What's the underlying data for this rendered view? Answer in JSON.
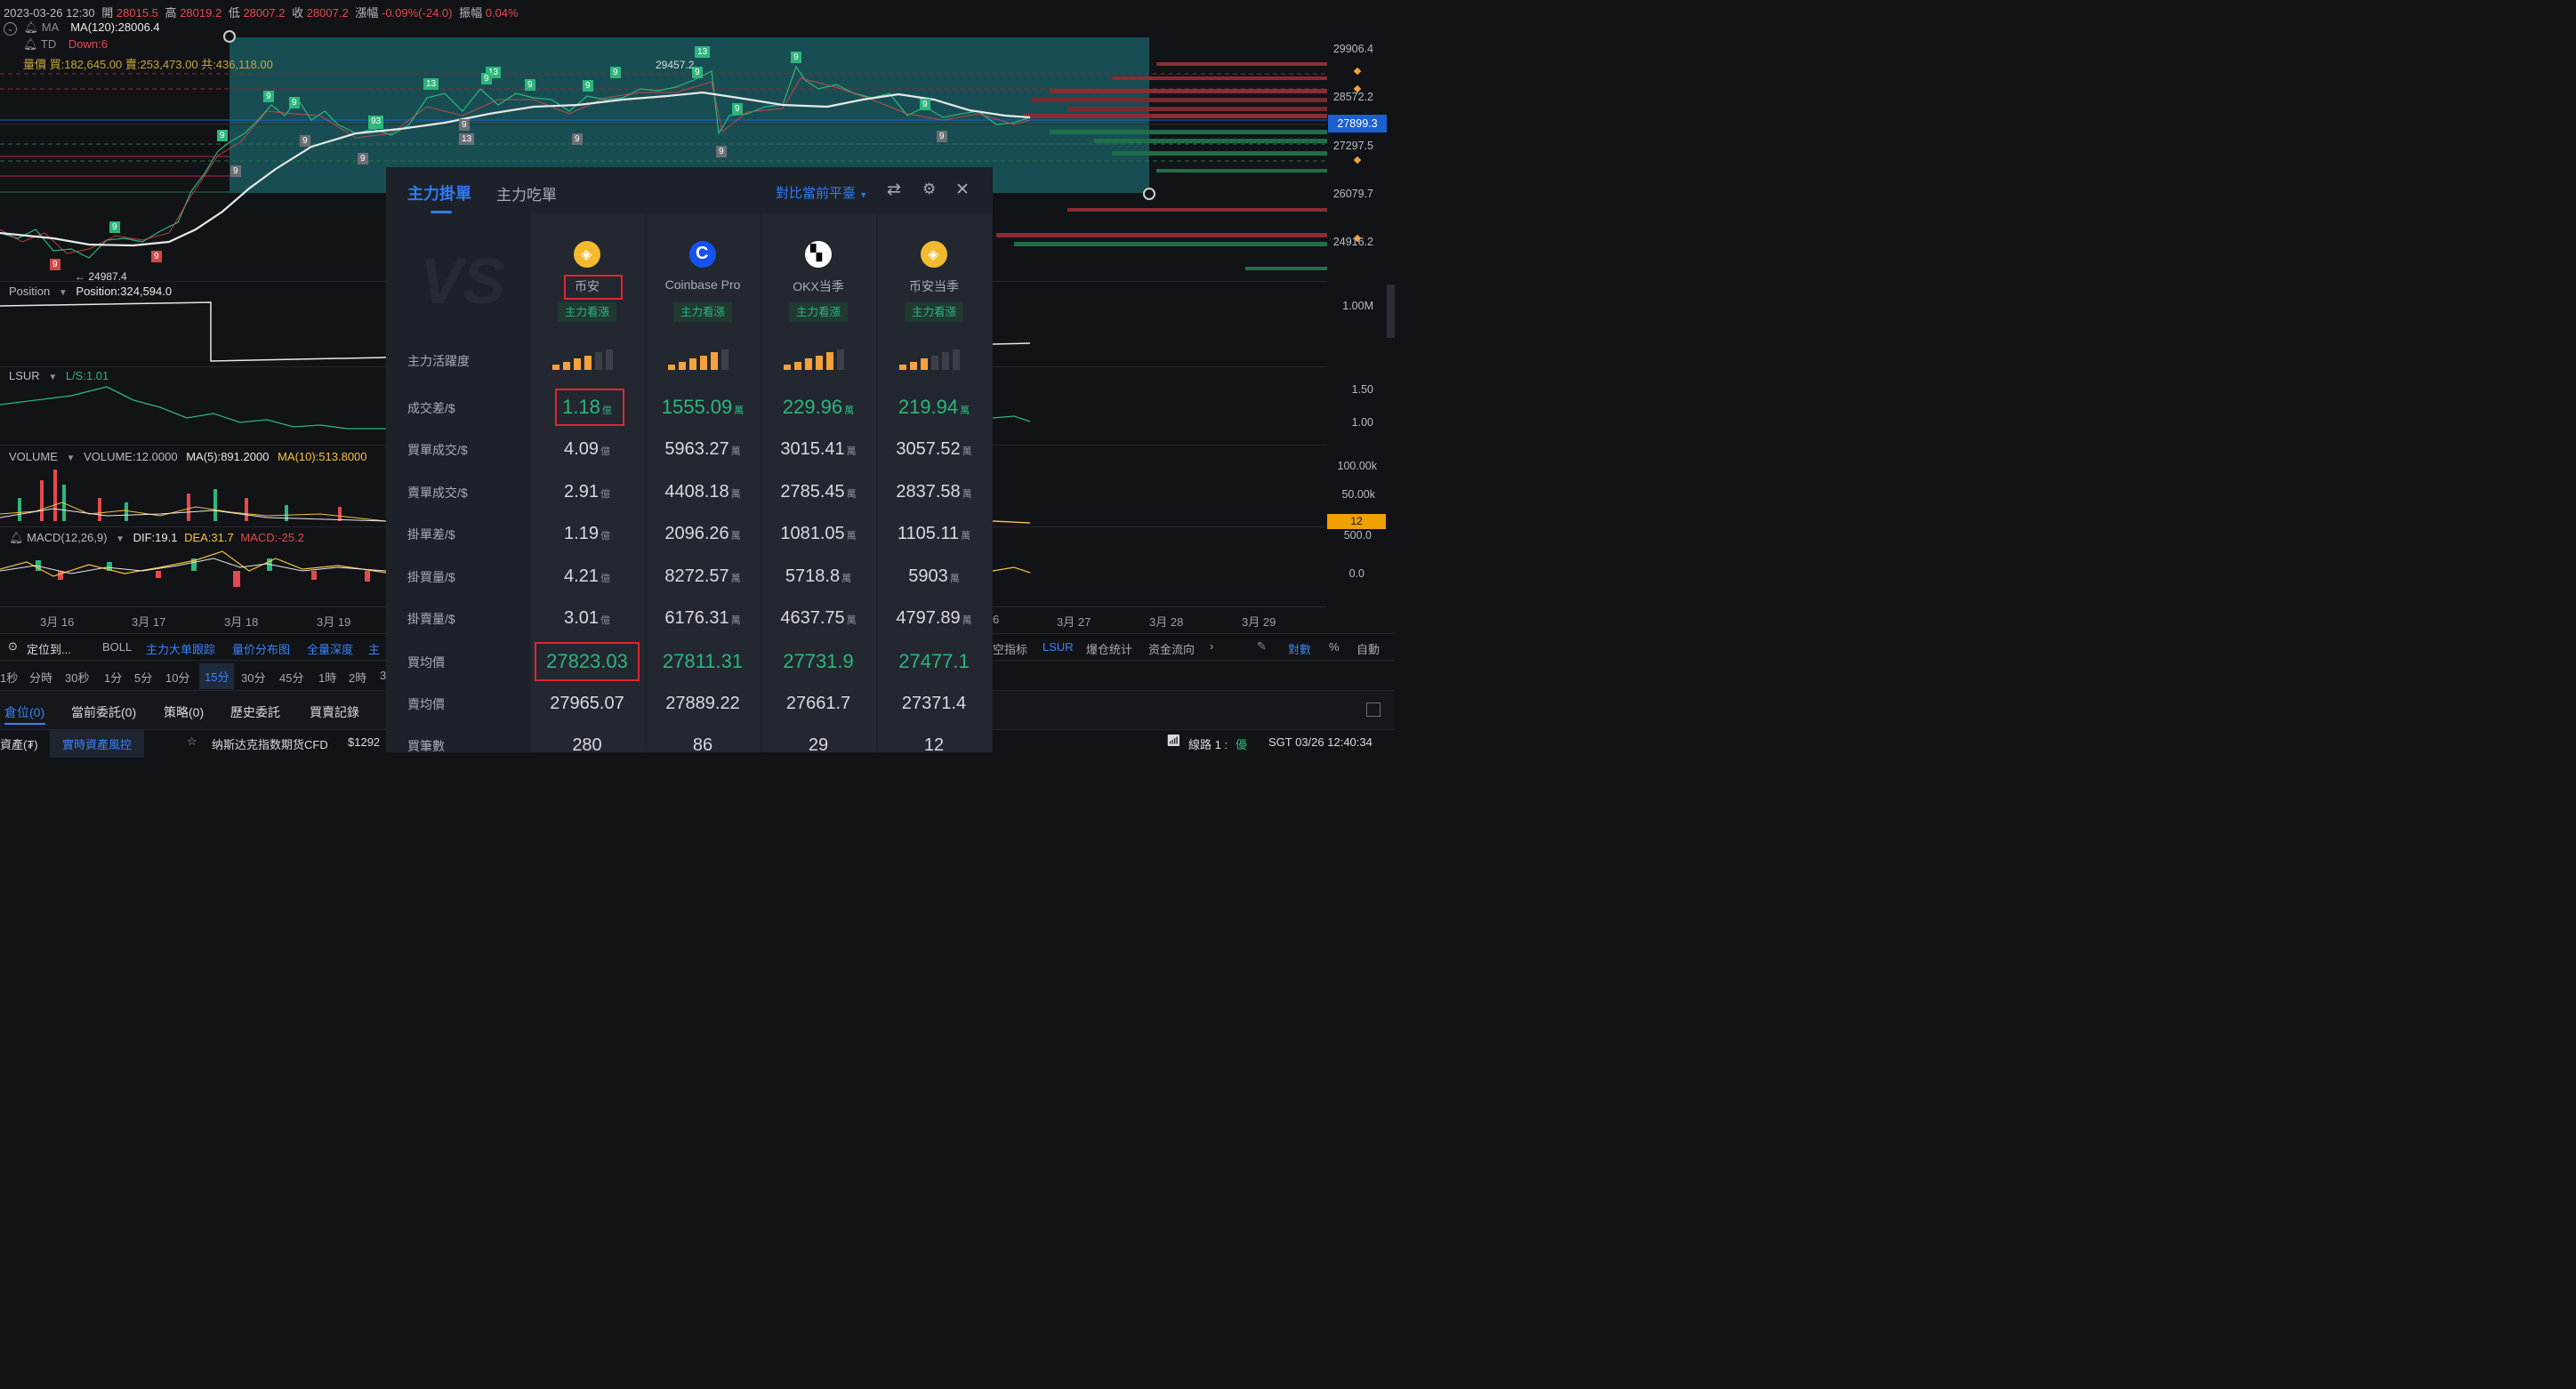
{
  "info": {
    "date": "2023-03-26 12:30",
    "open_label": "開",
    "open": "28015.5",
    "high_label": "高",
    "high": "28019.2",
    "low_label": "低",
    "low": "28007.2",
    "close_label": "收",
    "close": "28007.2",
    "change_label": "漲幅",
    "change": "-0.09%(-24.0)",
    "amp_label": "振幅",
    "amp": "0.04%"
  },
  "indicators": {
    "ma_name": "MA",
    "ma_value": "MA(120):28006.4",
    "td_name": "TD",
    "td_value": "Down:6",
    "vol_line": "量價 買:182,645.00 賣:253,473.00 共:436,118.00"
  },
  "chart_marks": {
    "low_price": "24987.4",
    "high_price": "29457.2",
    "td_counts": [
      "9",
      "9",
      "13",
      "9",
      "9",
      "9",
      "9",
      "93",
      "9",
      "9",
      "13",
      "13",
      "9",
      "9",
      "9",
      "9",
      "9",
      "13",
      "9",
      "9",
      "9",
      "9",
      "9",
      "9",
      "13",
      "9",
      "9"
    ]
  },
  "price_axis": [
    "29906.4",
    "28572.2",
    "27899.3",
    "27297.5",
    "26079.7",
    "24916.2"
  ],
  "panes": {
    "position": {
      "name": "Position",
      "value": "Position:324,594.0",
      "axis": "1.00M"
    },
    "lsur": {
      "name": "LSUR",
      "value": "L/S:1.01",
      "axis": [
        "1.50",
        "1.00"
      ]
    },
    "volume": {
      "name": "VOLUME",
      "value": "VOLUME:12.0000",
      "ma5": "MA(5):891.2000",
      "ma10": "MA(10):513.8000",
      "axis": [
        "100.00k",
        "50.00k"
      ],
      "current": "12"
    },
    "macd": {
      "name": "MACD(12,26,9)",
      "dif": "DIF:19.1",
      "dea": "DEA:31.7",
      "macd": "MACD:-25.2",
      "axis": [
        "500.0",
        "0.0"
      ]
    }
  },
  "x_axis": [
    "3月 16",
    "3月 17",
    "3月 18",
    "3月 19",
    "6",
    "3月 27",
    "3月 28",
    "3月 29"
  ],
  "toolbar1": {
    "locate": "定位到...",
    "items": [
      "BOLL",
      "主力大单跟踪",
      "量价分布图",
      "全量深度",
      "主"
    ],
    "right_items": [
      "空指标",
      "LSUR",
      "爆仓统计",
      "资金流向"
    ],
    "right_end": [
      "對數",
      "%",
      "自動"
    ]
  },
  "toolbar2": {
    "intervals": [
      "1秒",
      "分時",
      "30秒",
      "1分",
      "5分",
      "10分",
      "15分",
      "30分",
      "45分",
      "1時",
      "2時",
      "3"
    ],
    "active": "15分"
  },
  "toolbar3": {
    "tabs": [
      "倉位(0)",
      "當前委託(0)",
      "策略(0)",
      "歷史委託",
      "買賣記錄"
    ]
  },
  "status": {
    "assets": "資產(₮)",
    "risk": "實時資產風控",
    "ticker_name": "纳斯达克指数期货CFD",
    "ticker_price": "$1292",
    "line": "線路 1 :",
    "line_quality": "優",
    "time": "SGT 03/26 12:40:34"
  },
  "panel": {
    "tab_active": "主力掛單",
    "tab_other": "主力吃單",
    "compare": "對比當前平臺",
    "exchanges": [
      {
        "name": "币安",
        "badge": "主力看漲",
        "logo": "binance",
        "activity": 4
      },
      {
        "name": "Coinbase Pro",
        "badge": "主力看漲",
        "logo": "coinbase",
        "activity": 5
      },
      {
        "name": "OKX当季",
        "badge": "主力看漲",
        "logo": "okx",
        "activity": 5
      },
      {
        "name": "币安当季",
        "badge": "主力看漲",
        "logo": "binance",
        "activity": 3
      }
    ],
    "rows": [
      {
        "label": "主力活躍度",
        "type": "activity"
      },
      {
        "label": "成交差/$",
        "values": [
          [
            "1.18",
            "億"
          ],
          [
            "1555.09",
            "萬"
          ],
          [
            "229.96",
            "萬"
          ],
          [
            "219.94",
            "萬"
          ]
        ],
        "green": true
      },
      {
        "label": "買單成交/$",
        "values": [
          [
            "4.09",
            "億"
          ],
          [
            "5963.27",
            "萬"
          ],
          [
            "3015.41",
            "萬"
          ],
          [
            "3057.52",
            "萬"
          ]
        ]
      },
      {
        "label": "賣單成交/$",
        "values": [
          [
            "2.91",
            "億"
          ],
          [
            "4408.18",
            "萬"
          ],
          [
            "2785.45",
            "萬"
          ],
          [
            "2837.58",
            "萬"
          ]
        ]
      },
      {
        "label": "掛單差/$",
        "values": [
          [
            "1.19",
            "億"
          ],
          [
            "2096.26",
            "萬"
          ],
          [
            "1081.05",
            "萬"
          ],
          [
            "1105.11",
            "萬"
          ]
        ]
      },
      {
        "label": "掛買量/$",
        "values": [
          [
            "4.21",
            "億"
          ],
          [
            "8272.57",
            "萬"
          ],
          [
            "5718.8",
            "萬"
          ],
          [
            "5903",
            "萬"
          ]
        ]
      },
      {
        "label": "掛賣量/$",
        "values": [
          [
            "3.01",
            "億"
          ],
          [
            "6176.31",
            "萬"
          ],
          [
            "4637.75",
            "萬"
          ],
          [
            "4797.89",
            "萬"
          ]
        ]
      },
      {
        "label": "買均價",
        "values": [
          [
            "27823.03",
            ""
          ],
          [
            "27811.31",
            ""
          ],
          [
            "27731.9",
            ""
          ],
          [
            "27477.1",
            ""
          ]
        ],
        "green": true
      },
      {
        "label": "賣均價",
        "values": [
          [
            "27965.07",
            ""
          ],
          [
            "27889.22",
            ""
          ],
          [
            "27661.7",
            ""
          ],
          [
            "27371.4",
            ""
          ]
        ]
      },
      {
        "label": "買筆數",
        "values": [
          [
            "280",
            ""
          ],
          [
            "86",
            ""
          ],
          [
            "29",
            ""
          ],
          [
            "12",
            ""
          ]
        ]
      }
    ]
  }
}
